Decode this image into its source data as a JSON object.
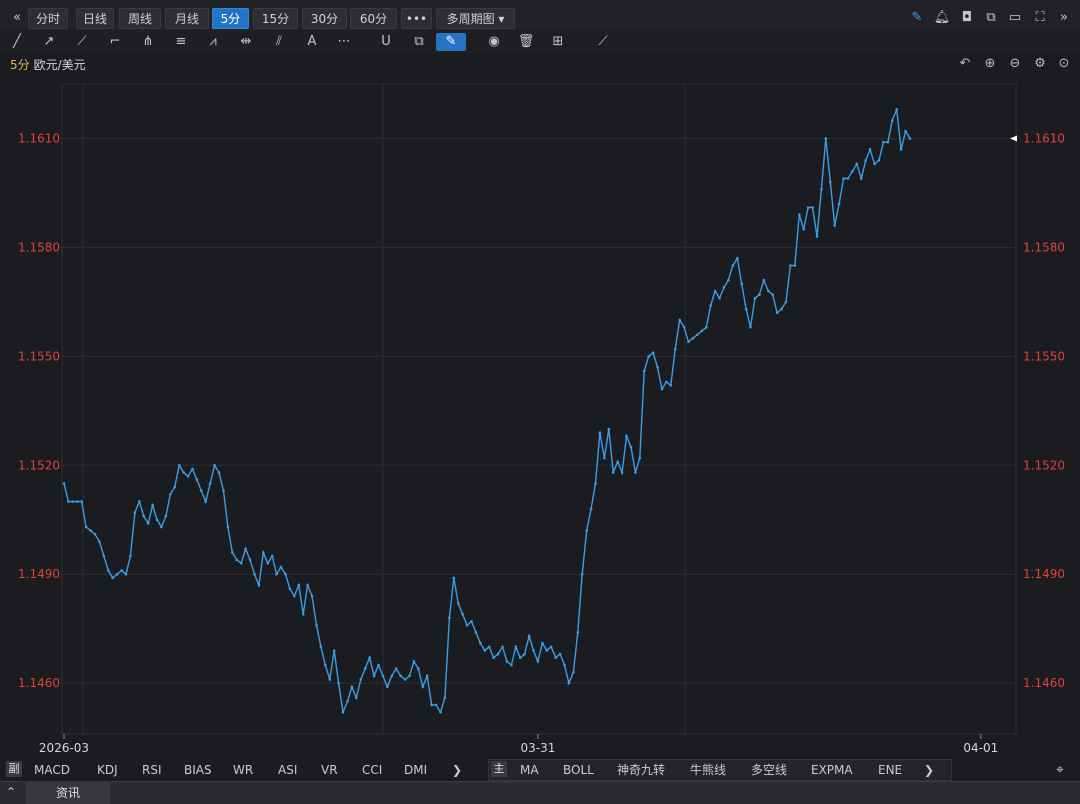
{
  "toolbar": {
    "collapse_icon": "double-chevron-left-icon",
    "periods": [
      {
        "label": "分时",
        "active": false
      },
      {
        "label": "日线",
        "active": false
      },
      {
        "label": "周线",
        "active": false
      },
      {
        "label": "月线",
        "active": false
      },
      {
        "label": "5分",
        "active": true
      },
      {
        "label": "15分",
        "active": false
      },
      {
        "label": "30分",
        "active": false
      },
      {
        "label": "60分",
        "active": false
      }
    ],
    "more_label": "•••",
    "multi_label": "多周期图 ▾",
    "right_icons": [
      "pen-icon",
      "bell-icon",
      "camera-icon",
      "copy-window-icon",
      "monitor-icon",
      "fullscreen-icon",
      "double-chevron-right-icon"
    ]
  },
  "drawing_tools": [
    "line-icon",
    "ray-icon",
    "polyline-icon",
    "rect-icon",
    "fork-icon",
    "fibonacci-icon",
    "fan-icon",
    "measure-icon",
    "channel-icon",
    "text-icon",
    "more-icon",
    "magnet-icon",
    "clone-icon",
    "brush-icon",
    "eye-icon",
    "trash-icon",
    "layers-icon",
    "ruler-icon"
  ],
  "chart_header": {
    "period": "5分",
    "symbol": "欧元/美元",
    "icons": [
      "undo-icon",
      "zoom-in-icon",
      "zoom-out-icon",
      "settings-icon",
      "target-icon"
    ]
  },
  "chart_data": {
    "type": "line",
    "title": "5分 欧元/美元",
    "y_ticks": [
      "1.1610",
      "1.1580",
      "1.1550",
      "1.1520",
      "1.1490",
      "1.1460"
    ],
    "y_tick_values": [
      1.161,
      1.158,
      1.155,
      1.152,
      1.149,
      1.146
    ],
    "x_ticks": [
      "2026-03",
      "03-31",
      "04-01"
    ],
    "x_tick_index": [
      0,
      107,
      207
    ],
    "ylim": [
      1.1446,
      1.1625
    ],
    "last_price": "1.1610",
    "line_color": "#3a9ee8",
    "grid_color": "#2c2d33",
    "axis_label_color": "#e0413b",
    "series": [
      {
        "values": [
          1.1515,
          1.151,
          1.151,
          1.151,
          1.151,
          1.1503,
          1.1502,
          1.1501,
          1.1499,
          1.1495,
          1.1491,
          1.1489,
          1.149,
          1.1491,
          1.149,
          1.1495,
          1.1507,
          1.151,
          1.1506,
          1.1504,
          1.1509,
          1.1505,
          1.1503,
          1.1506,
          1.1512,
          1.1514,
          1.152,
          1.1518,
          1.1517,
          1.1519,
          1.1516,
          1.1513,
          1.151,
          1.1515,
          1.152,
          1.1518,
          1.1513,
          1.1503,
          1.1496,
          1.1494,
          1.1493,
          1.1497,
          1.1494,
          1.149,
          1.1487,
          1.1496,
          1.1493,
          1.1495,
          1.149,
          1.1492,
          1.149,
          1.1486,
          1.1484,
          1.1487,
          1.1479,
          1.1487,
          1.1484,
          1.1476,
          1.147,
          1.1465,
          1.1461,
          1.1469,
          1.146,
          1.1452,
          1.1455,
          1.1459,
          1.1456,
          1.1461,
          1.1464,
          1.1467,
          1.1462,
          1.1465,
          1.1462,
          1.1459,
          1.1462,
          1.1464,
          1.1462,
          1.1461,
          1.1462,
          1.1466,
          1.1464,
          1.1459,
          1.1462,
          1.1454,
          1.1454,
          1.1452,
          1.1456,
          1.1478,
          1.1489,
          1.1482,
          1.1479,
          1.1476,
          1.1477,
          1.1474,
          1.1471,
          1.1469,
          1.147,
          1.1467,
          1.1468,
          1.147,
          1.1466,
          1.1465,
          1.147,
          1.1467,
          1.1468,
          1.1473,
          1.1469,
          1.1466,
          1.1471,
          1.1469,
          1.147,
          1.1467,
          1.1468,
          1.1465,
          1.146,
          1.1463,
          1.1474,
          1.149,
          1.1502,
          1.1508,
          1.1515,
          1.1529,
          1.1522,
          1.153,
          1.1518,
          1.1521,
          1.1518,
          1.1528,
          1.1525,
          1.1518,
          1.1522,
          1.1546,
          1.155,
          1.1551,
          1.1547,
          1.1541,
          1.1543,
          1.1542,
          1.1552,
          1.156,
          1.1558,
          1.1554,
          1.1555,
          1.1556,
          1.1557,
          1.1558,
          1.1564,
          1.1568,
          1.1566,
          1.1569,
          1.1571,
          1.1575,
          1.1577,
          1.157,
          1.1563,
          1.1558,
          1.1566,
          1.1567,
          1.1571,
          1.1568,
          1.1567,
          1.1562,
          1.1563,
          1.1565,
          1.1575,
          1.1575,
          1.1589,
          1.1585,
          1.1591,
          1.1591,
          1.1583,
          1.1596,
          1.161,
          1.1598,
          1.1586,
          1.1592,
          1.1599,
          1.1599,
          1.1601,
          1.1603,
          1.1599,
          1.1604,
          1.1607,
          1.1603,
          1.1604,
          1.1609,
          1.1609,
          1.1615,
          1.1618,
          1.1607,
          1.1612,
          1.161
        ]
      }
    ]
  },
  "indicators": {
    "sub_tag": "副",
    "sub_items": [
      "MACD",
      "KDJ",
      "RSI",
      "BIAS",
      "WR",
      "ASI",
      "VR",
      "CCI",
      "DMI"
    ],
    "main_tag": "主",
    "main_items": [
      "MA",
      "BOLL",
      "神奇九转",
      "牛熊线",
      "多空线",
      "EXPMA",
      "ENE"
    ],
    "more_icon": "chevron-right-icon",
    "locate_icon": "location-pin-icon"
  },
  "bottom": {
    "expand_icon": "double-chevron-up-icon",
    "tab_label": "资讯"
  }
}
